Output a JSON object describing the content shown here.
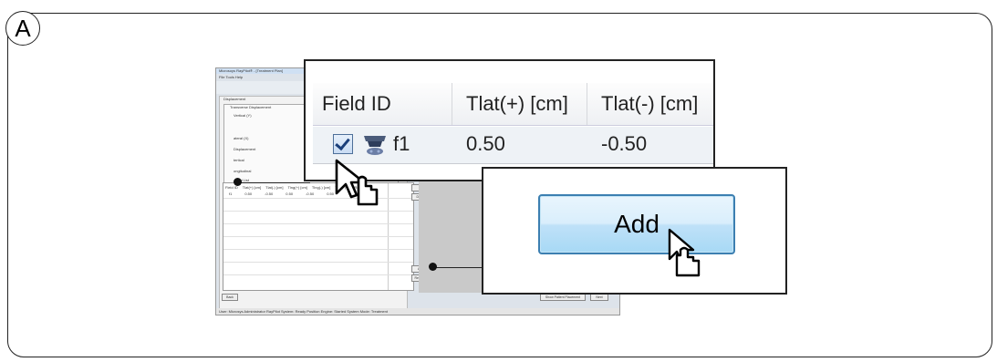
{
  "step_label": "A",
  "background_window": {
    "title": "Microsoys RayPilot® - [Treatment Plan]",
    "menu": "File   Tools   Help",
    "displacement_group": "Displacement",
    "transverse_group": "Transverse Displacement",
    "vertical_label": "Vertical (Y)",
    "lateral_label": "ateral (X)",
    "displacement_sub": "Displacement",
    "vertical2": "tertical",
    "longitudinal": "ongitudinal",
    "zero": "0",
    "field_list_title": "Field List",
    "mini_headers": [
      "Field ID",
      "Tlat(+) [cm]",
      "Tlat(-) [cm]",
      "Tlng(+) [cm]",
      "Tlng(-) [cm]",
      "Tvrt(+) [c",
      "Rotation"
    ],
    "mini_row": [
      "f1",
      "0.50",
      "-0.50",
      "0.50",
      "-0.50",
      "0.50"
    ],
    "btn_up": "Up",
    "btn_down": "Down",
    "btn_add": "Add",
    "btn_remove": "Remove",
    "btn_back": "Back",
    "btn_show_patient": "Show Patient Placement",
    "btn_next": "Next",
    "status": "User: Microsys Administrator    RayPilot System: Ready    Position Engine: Started    System Mode: Treatment"
  },
  "zoom_table": {
    "headers": [
      "Field ID",
      "Tlat(+) [cm]",
      "Tlat(-) [cm]"
    ],
    "row": {
      "field_id": "f1",
      "tlat_plus": "0.50",
      "tlat_minus": "-0.50",
      "checked": true
    }
  },
  "zoom_button": {
    "label": "Add"
  },
  "colors": {
    "button_border": "#3c7fb1",
    "button_fill": "#bfe1f8",
    "checkbox": "#1a3f7a"
  }
}
